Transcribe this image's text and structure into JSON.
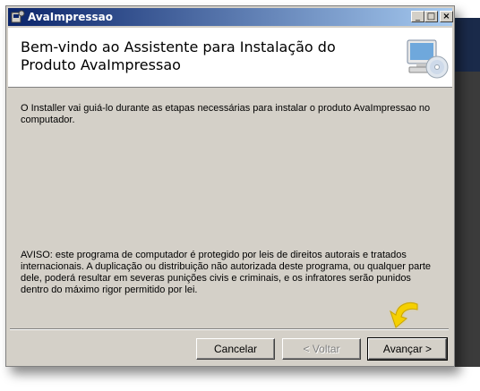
{
  "window": {
    "title": "AvaImpressao",
    "controls": {
      "minimize": "_",
      "maximize": "□",
      "close": "×"
    }
  },
  "header": {
    "heading": "Bem-vindo ao Assistente para Instalação do Produto AvaImpressao",
    "icon": "computer-cd-icon"
  },
  "content": {
    "intro": "O Installer vai guiá-lo durante as etapas necessárias para instalar o produto AvaImpressao no computador.",
    "notice": "AVISO: este programa de computador é protegido por leis de direitos autorais e tratados internacionais. A duplicação ou distribuição não autorizada deste programa, ou qualquer parte dele, poderá resultar em severas punições civis e criminais, e os infratores serão punidos dentro do máximo rigor permitido por lei."
  },
  "buttons": {
    "cancel": "Cancelar",
    "back": "< Voltar",
    "next": "Avançar >"
  },
  "colors": {
    "titlebar_start": "#0a246a",
    "titlebar_end": "#a6caf0",
    "dialog_bg": "#d4d0c8",
    "highlight_arrow": "#f5d000"
  }
}
